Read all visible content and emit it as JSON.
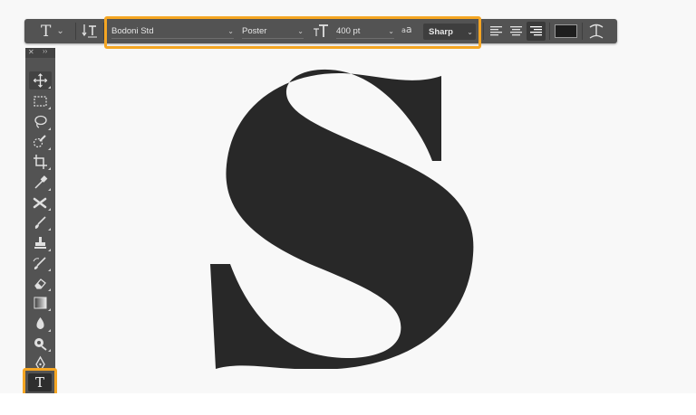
{
  "options_bar": {
    "tool_preset_icon": "type-tool-icon",
    "tool_preset_glyph": "T",
    "orientation_icon": "toggle-text-orientation-icon",
    "font_family": "Bodoni Std",
    "font_style": "Poster",
    "font_size_icon": "font-size-icon",
    "font_size": "400 pt",
    "antialias_icon_text": "a",
    "antialias_icon_small": "a",
    "antialias": "Sharp",
    "align_icons": [
      "align-left-icon",
      "align-center-icon",
      "align-right-icon"
    ],
    "text_color": "#1e1e1e",
    "warp_icon": "warp-text-icon"
  },
  "tools_panel": {
    "close_glyph": "✕",
    "collapse_glyph": "››",
    "tools": [
      "move-tool-icon",
      "marquee-tool-icon",
      "lasso-tool-icon",
      "quick-selection-tool-icon",
      "crop-tool-icon",
      "eyedropper-tool-icon",
      "spot-healing-tool-icon",
      "brush-tool-icon",
      "clone-stamp-tool-icon",
      "history-brush-tool-icon",
      "eraser-tool-icon",
      "gradient-tool-icon",
      "blur-tool-icon",
      "dodge-tool-icon",
      "pen-tool-icon",
      "type-tool-icon"
    ],
    "active_tool_glyph": "T"
  },
  "canvas": {
    "text": "S",
    "glyph_color": "#282828",
    "background": "#f8f8f8"
  },
  "highlight_color": "#f5a623"
}
